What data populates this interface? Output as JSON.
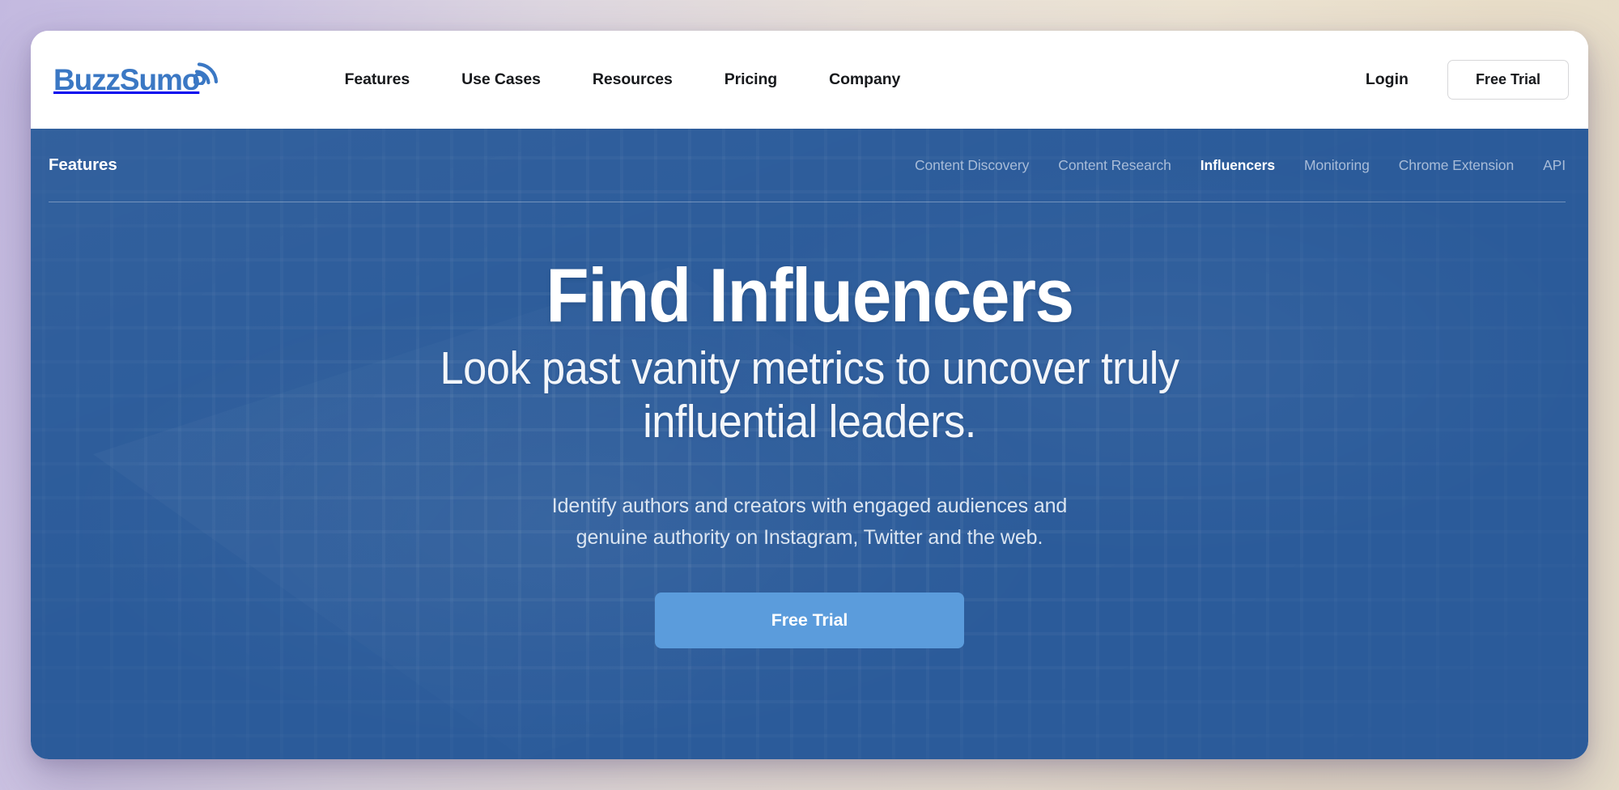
{
  "header": {
    "logo": {
      "text": "BuzzSumo",
      "icon": "wifi-signal-icon",
      "color": "#3b78c4"
    },
    "nav": [
      {
        "label": "Features"
      },
      {
        "label": "Use Cases"
      },
      {
        "label": "Resources"
      },
      {
        "label": "Pricing"
      },
      {
        "label": "Company"
      }
    ],
    "login_label": "Login",
    "trial_label": "Free Trial"
  },
  "subnav": {
    "title": "Features",
    "links": [
      {
        "label": "Content Discovery",
        "active": false
      },
      {
        "label": "Content Research",
        "active": false
      },
      {
        "label": "Influencers",
        "active": true
      },
      {
        "label": "Monitoring",
        "active": false
      },
      {
        "label": "Chrome Extension",
        "active": false
      },
      {
        "label": "API",
        "active": false
      }
    ]
  },
  "hero": {
    "title": "Find Influencers",
    "subtitle_line1": "Look past vanity metrics to uncover truly",
    "subtitle_line2": "influential leaders.",
    "desc_line1": "Identify authors and creators with engaged audiences and",
    "desc_line2": "genuine authority on Instagram, Twitter and the web.",
    "cta_label": "Free Trial",
    "background_color": "#2b5b9a",
    "cta_color": "#5b9cdc"
  }
}
